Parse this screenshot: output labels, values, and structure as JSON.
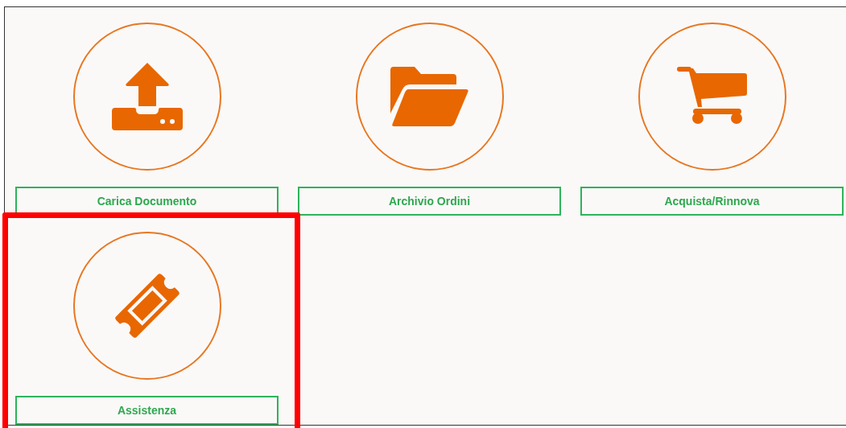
{
  "tiles": [
    {
      "label": "Carica Documento",
      "highlighted": false
    },
    {
      "label": "Archivio Ordini",
      "highlighted": false
    },
    {
      "label": "Acquista/Rinnova",
      "highlighted": false
    },
    {
      "label": "Assistenza",
      "highlighted": true
    }
  ]
}
